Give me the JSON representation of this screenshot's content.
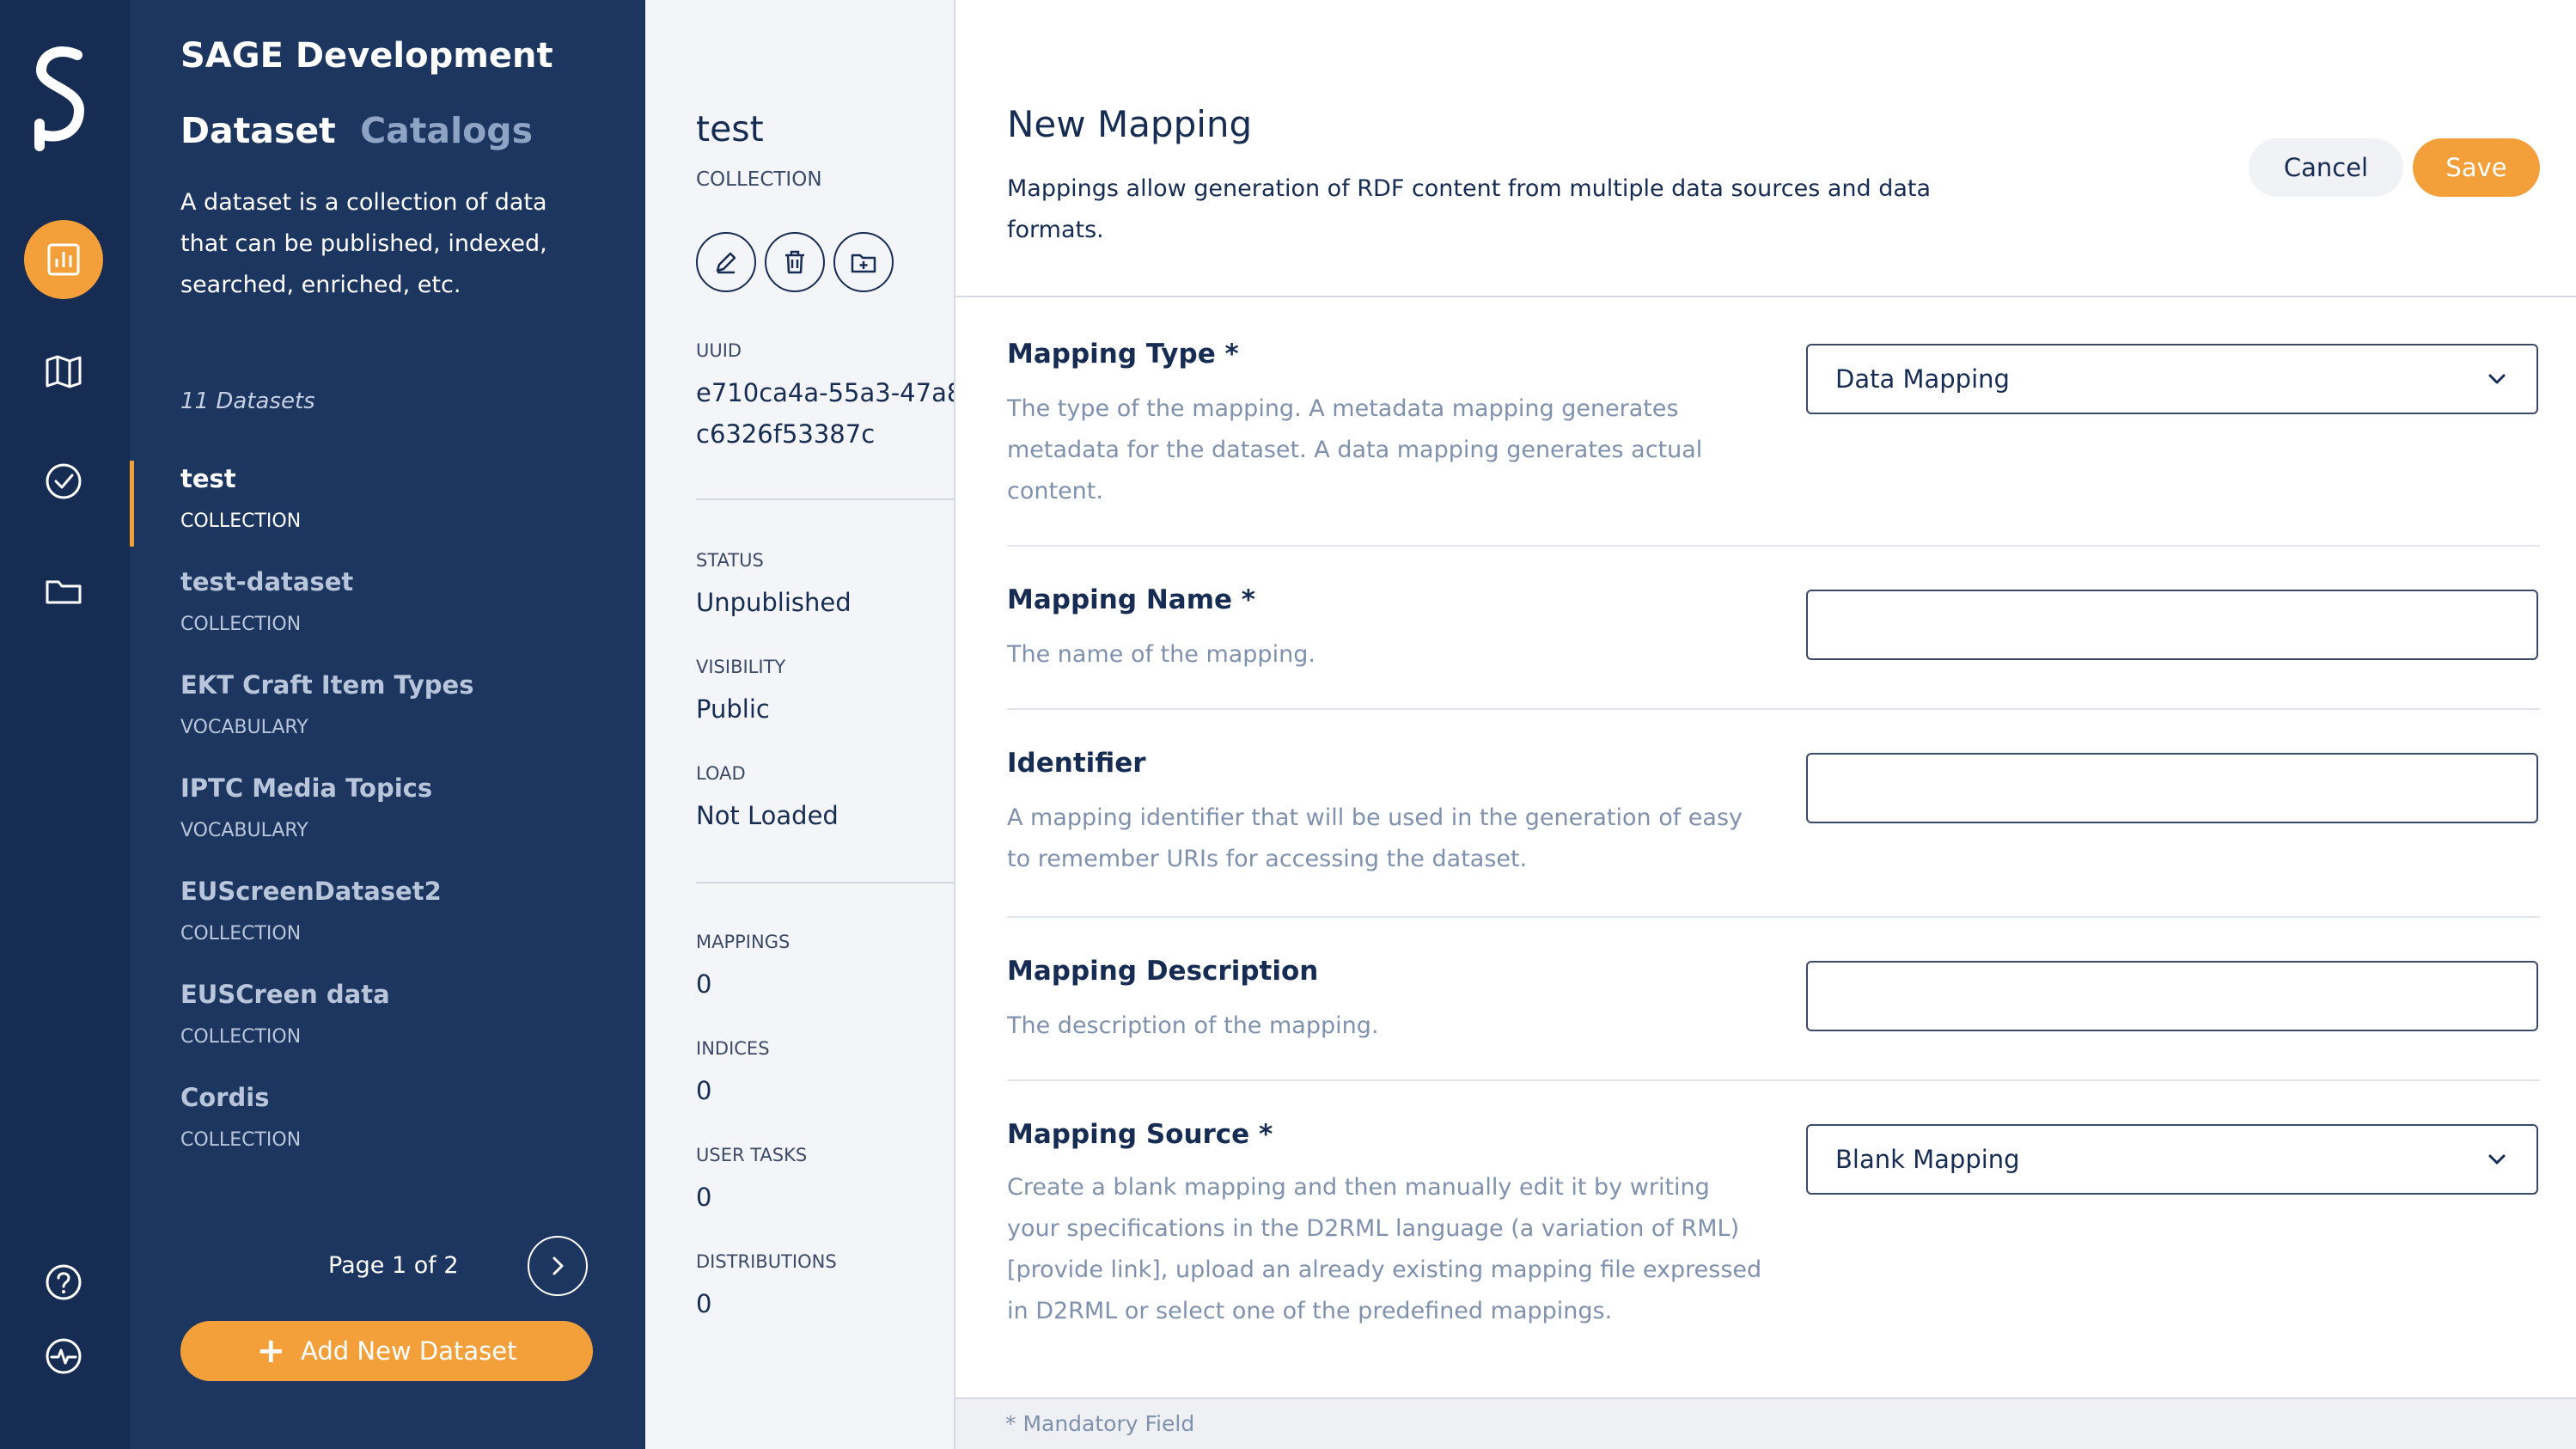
{
  "app": {
    "title": "SAGE Development"
  },
  "nav": {
    "icons": [
      "dataset-icon",
      "map-icon",
      "check-circle-icon",
      "folder-icon",
      "help-icon",
      "activity-icon"
    ]
  },
  "sidebar": {
    "tabs": [
      "Dataset",
      "Catalogs"
    ],
    "description": "A dataset is a collection of data that can be published, indexed, searched, enriched, etc.",
    "count_label": "11 Datasets",
    "datasets": [
      {
        "name": "test",
        "type": "COLLECTION"
      },
      {
        "name": "test-dataset",
        "type": "COLLECTION"
      },
      {
        "name": "EKT Craft Item Types",
        "type": "VOCABULARY"
      },
      {
        "name": "IPTC Media Topics",
        "type": "VOCABULARY"
      },
      {
        "name": "EUScreenDataset2",
        "type": "COLLECTION"
      },
      {
        "name": "EUSCreen data",
        "type": "COLLECTION"
      },
      {
        "name": "Cordis",
        "type": "COLLECTION"
      }
    ],
    "pager": "Page 1 of 2",
    "add_label": "Add New Dataset"
  },
  "detail": {
    "title": "test",
    "subtitle": "COLLECTION",
    "uuid_label": "UUID",
    "uuid_line1": "e710ca4a-55a3-47a8",
    "uuid_line2": "c6326f53387c",
    "status_label": "STATUS",
    "status": "Unpublished",
    "visibility_label": "VISIBILITY",
    "visibility": "Public",
    "load_label": "LOAD",
    "load": "Not Loaded",
    "mappings_label": "MAPPINGS",
    "mappings": "0",
    "indices_label": "INDICES",
    "indices": "0",
    "user_tasks_label": "USER TASKS",
    "user_tasks": "0",
    "distributions_label": "DISTRIBUTIONS",
    "distributions": "0"
  },
  "modal": {
    "title": "New Mapping",
    "description": "Mappings allow generation of RDF content from multiple data sources and data formats.",
    "cancel": "Cancel",
    "save": "Save",
    "fields": {
      "type": {
        "label": "Mapping Type *",
        "help": "The type of the mapping. A metadata mapping generates metadata for the dataset. A data mapping generates actual content.",
        "value": "Data Mapping"
      },
      "name": {
        "label": "Mapping Name *",
        "help": "The name of the mapping.",
        "value": ""
      },
      "identifier": {
        "label": "Identifier",
        "help": "A mapping identifier that will be used in the generation of easy to remember URIs for accessing the dataset.",
        "value": ""
      },
      "description": {
        "label": "Mapping Description",
        "help": "The description of the mapping.",
        "value": ""
      },
      "source": {
        "label": "Mapping Source *",
        "help": "Create a blank mapping and then manually edit it by writing your specifications in the D2RML language (a variation of RML) [provide link], upload an already existing mapping file expressed in D2RML or select one of the predefined mappings.",
        "value": "Blank Mapping"
      }
    },
    "footer": "* Mandatory Field"
  },
  "colors": {
    "navy": "#172c52",
    "sidebar": "#1d3660",
    "accent": "#f3a03a"
  }
}
